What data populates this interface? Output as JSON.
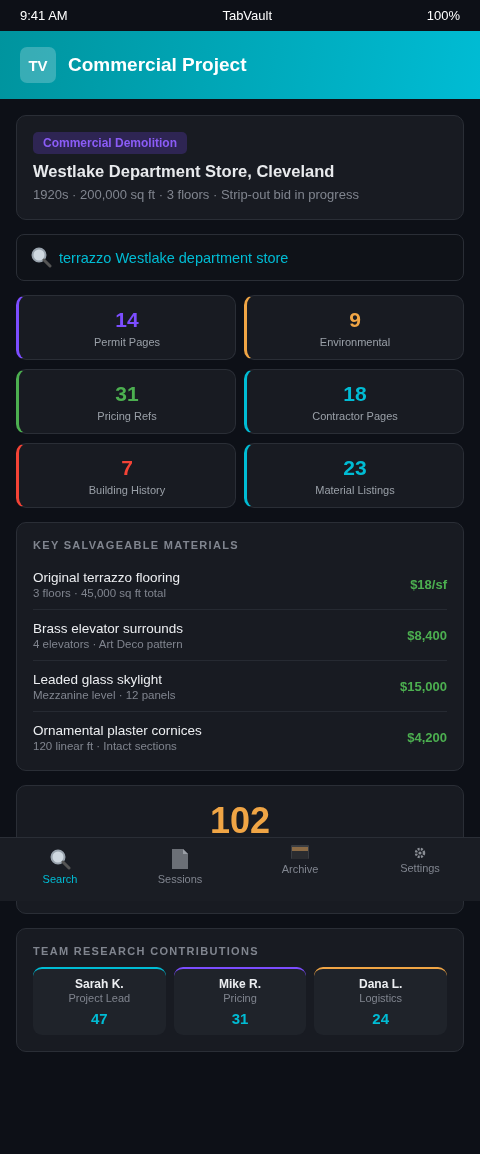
{
  "status_bar": {
    "time": "9:41 AM",
    "title": "TabVault",
    "battery": "100%"
  },
  "header": {
    "logo": "TV",
    "title": "Commercial Project"
  },
  "project": {
    "tag": "Commercial Demolition",
    "name": "Westlake Department Store, Cleveland",
    "details": "1920s · 200,000 sq ft · 3 floors · Strip-out bid in progress"
  },
  "search": {
    "value": "terrazzo Westlake department store"
  },
  "stats": [
    {
      "value": "14",
      "label": "Permit Pages",
      "color": "#7c4dff"
    },
    {
      "value": "9",
      "label": "Environmental",
      "color": "#f0a545"
    },
    {
      "value": "31",
      "label": "Pricing Refs",
      "color": "#4caf50"
    },
    {
      "value": "18",
      "label": "Contractor Pages",
      "color": "#00bcd4"
    },
    {
      "value": "7",
      "label": "Building History",
      "color": "#f44336"
    },
    {
      "value": "23",
      "label": "Material Listings",
      "color": "#00bcd4"
    }
  ],
  "materials": {
    "title": "KEY SALVAGEABLE MATERIALS",
    "items": [
      {
        "name": "Original terrazzo flooring",
        "details": "3 floors · 45,000 sq ft total",
        "price": "$18/sf"
      },
      {
        "name": "Brass elevator surrounds",
        "details": "4 elevators · Art Deco pattern",
        "price": "$8,400"
      },
      {
        "name": "Leaded glass skylight",
        "details": "Mezzanine level · 12 panels",
        "price": "$15,000"
      },
      {
        "name": "Ornamental plaster cornices",
        "details": "120 linear ft · Intact sections",
        "price": "$4,200"
      }
    ]
  },
  "total": {
    "value": "102"
  },
  "nav": [
    {
      "label": "Search",
      "selected": true
    },
    {
      "label": "Sessions",
      "selected": false
    },
    {
      "label": "Archive",
      "selected": false
    },
    {
      "label": "Settings",
      "selected": false
    }
  ],
  "team": {
    "title": "TEAM RESEARCH CONTRIBUTIONS",
    "members": [
      {
        "name": "Sarah K.",
        "role": "Project Lead",
        "count": "47",
        "color": "#00bcd4"
      },
      {
        "name": "Mike R.",
        "role": "Pricing",
        "count": "31",
        "color": "#7c4dff"
      },
      {
        "name": "Dana L.",
        "role": "Logistics",
        "count": "24",
        "color": "#f0a545"
      }
    ]
  }
}
